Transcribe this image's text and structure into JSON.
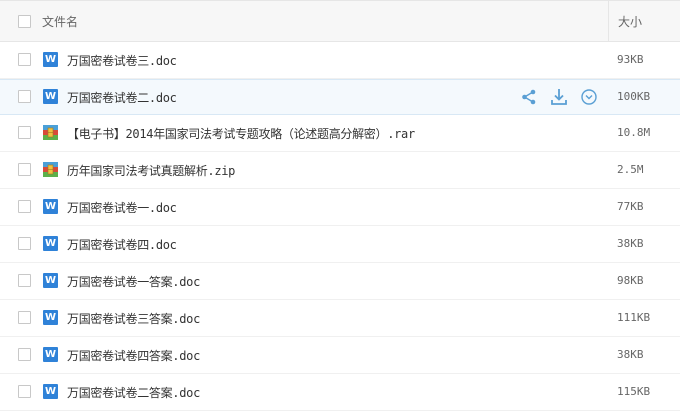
{
  "header": {
    "name_label": "文件名",
    "size_label": "大小"
  },
  "files": [
    {
      "name": "万国密卷试卷三.doc",
      "size": "93KB",
      "type": "doc"
    },
    {
      "name": "万国密卷试卷二.doc",
      "size": "100KB",
      "type": "doc",
      "hover": true
    },
    {
      "name": "【电子书】2014年国家司法考试专题攻略（论述题高分解密）.rar",
      "size": "10.8M",
      "type": "archive"
    },
    {
      "name": "历年国家司法考试真题解析.zip",
      "size": "2.5M",
      "type": "archive"
    },
    {
      "name": "万国密卷试卷一.doc",
      "size": "77KB",
      "type": "doc"
    },
    {
      "name": "万国密卷试卷四.doc",
      "size": "38KB",
      "type": "doc"
    },
    {
      "name": "万国密卷试卷一答案.doc",
      "size": "98KB",
      "type": "doc"
    },
    {
      "name": "万国密卷试卷三答案.doc",
      "size": "111KB",
      "type": "doc"
    },
    {
      "name": "万国密卷试卷四答案.doc",
      "size": "38KB",
      "type": "doc"
    },
    {
      "name": "万国密卷试卷二答案.doc",
      "size": "115KB",
      "type": "doc"
    }
  ],
  "icons": {
    "doc_letter": "W",
    "share": "share-icon",
    "download": "download-icon",
    "more": "more-icon"
  },
  "colors": {
    "accent": "#2f82d8",
    "action": "#5a9fd4",
    "hover_bg": "#f4f9fd"
  }
}
